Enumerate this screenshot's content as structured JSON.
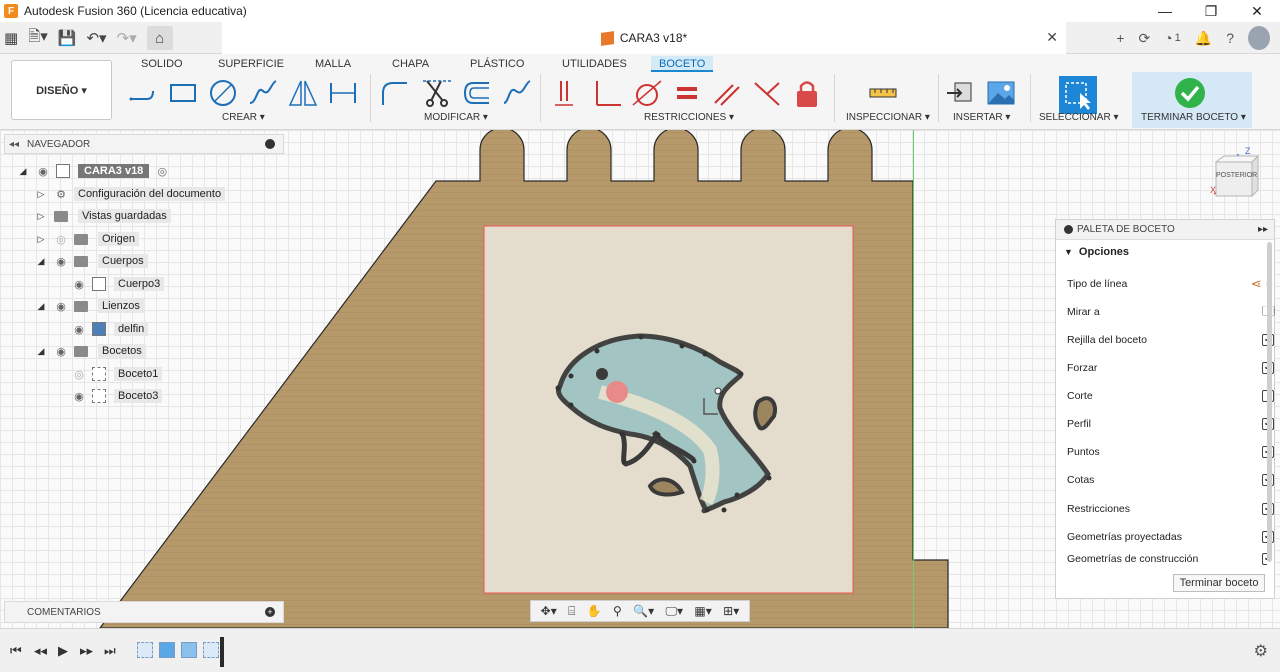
{
  "window": {
    "title": "Autodesk Fusion 360 (Licencia educativa)",
    "app_icon": "F",
    "controls": [
      "—",
      "❐",
      "✕"
    ]
  },
  "tabbar": {
    "doc_name": "CARA3 v18*",
    "notifications_count": "1"
  },
  "ribbon": {
    "workspace": "DISEÑO ▾",
    "tabs": [
      "SOLIDO",
      "SUPERFICIE",
      "MALLA",
      "CHAPA",
      "PLÁSTICO",
      "UTILIDADES",
      "BOCETO"
    ],
    "active_tab": "BOCETO",
    "groups": {
      "create": "CREAR ▾",
      "modify": "MODIFICAR ▾",
      "constraints": "RESTRICCIONES ▾",
      "inspect": "INSPECCIONAR ▾",
      "insert": "INSERTAR ▾",
      "select": "SELECCIONAR ▾",
      "finish": "TERMINAR BOCETO ▾"
    },
    "accent": "#0a6ab8"
  },
  "navigator": {
    "title": "NAVEGADOR",
    "root": "CARA3 v18",
    "items": [
      {
        "label": "Configuración del documento"
      },
      {
        "label": "Vistas guardadas"
      },
      {
        "label": "Origen"
      },
      {
        "label": "Cuerpos"
      },
      {
        "label": "Cuerpo3"
      },
      {
        "label": "Lienzos"
      },
      {
        "label": "delfin"
      },
      {
        "label": "Bocetos"
      },
      {
        "label": "Boceto1"
      },
      {
        "label": "Boceto3"
      }
    ]
  },
  "comments": {
    "title": "COMENTARIOS"
  },
  "palette": {
    "title": "PALETA DE BOCETO",
    "section": "Opciones",
    "rows": [
      {
        "label": "Tipo de línea",
        "type": "icons"
      },
      {
        "label": "Mirar a",
        "type": "icon"
      },
      {
        "label": "Rejilla del boceto",
        "checked": "✓"
      },
      {
        "label": "Forzar",
        "checked": "✓"
      },
      {
        "label": "Corte",
        "checked": ""
      },
      {
        "label": "Perfil",
        "checked": "✓"
      },
      {
        "label": "Puntos",
        "checked": "✓"
      },
      {
        "label": "Cotas",
        "checked": "✓"
      },
      {
        "label": "Restricciones",
        "checked": "✓"
      },
      {
        "label": "Geometrías proyectadas",
        "checked": "✓"
      },
      {
        "label": "Geometrías de construcción",
        "checked": "✓"
      }
    ],
    "finish_button": "Terminar boceto"
  },
  "viewcube": {
    "face": "POSTERIOR",
    "z": "Z",
    "x": "X"
  },
  "canvas": {
    "wood_color": "#b59a6a",
    "canvas_image_label": "delfin"
  }
}
